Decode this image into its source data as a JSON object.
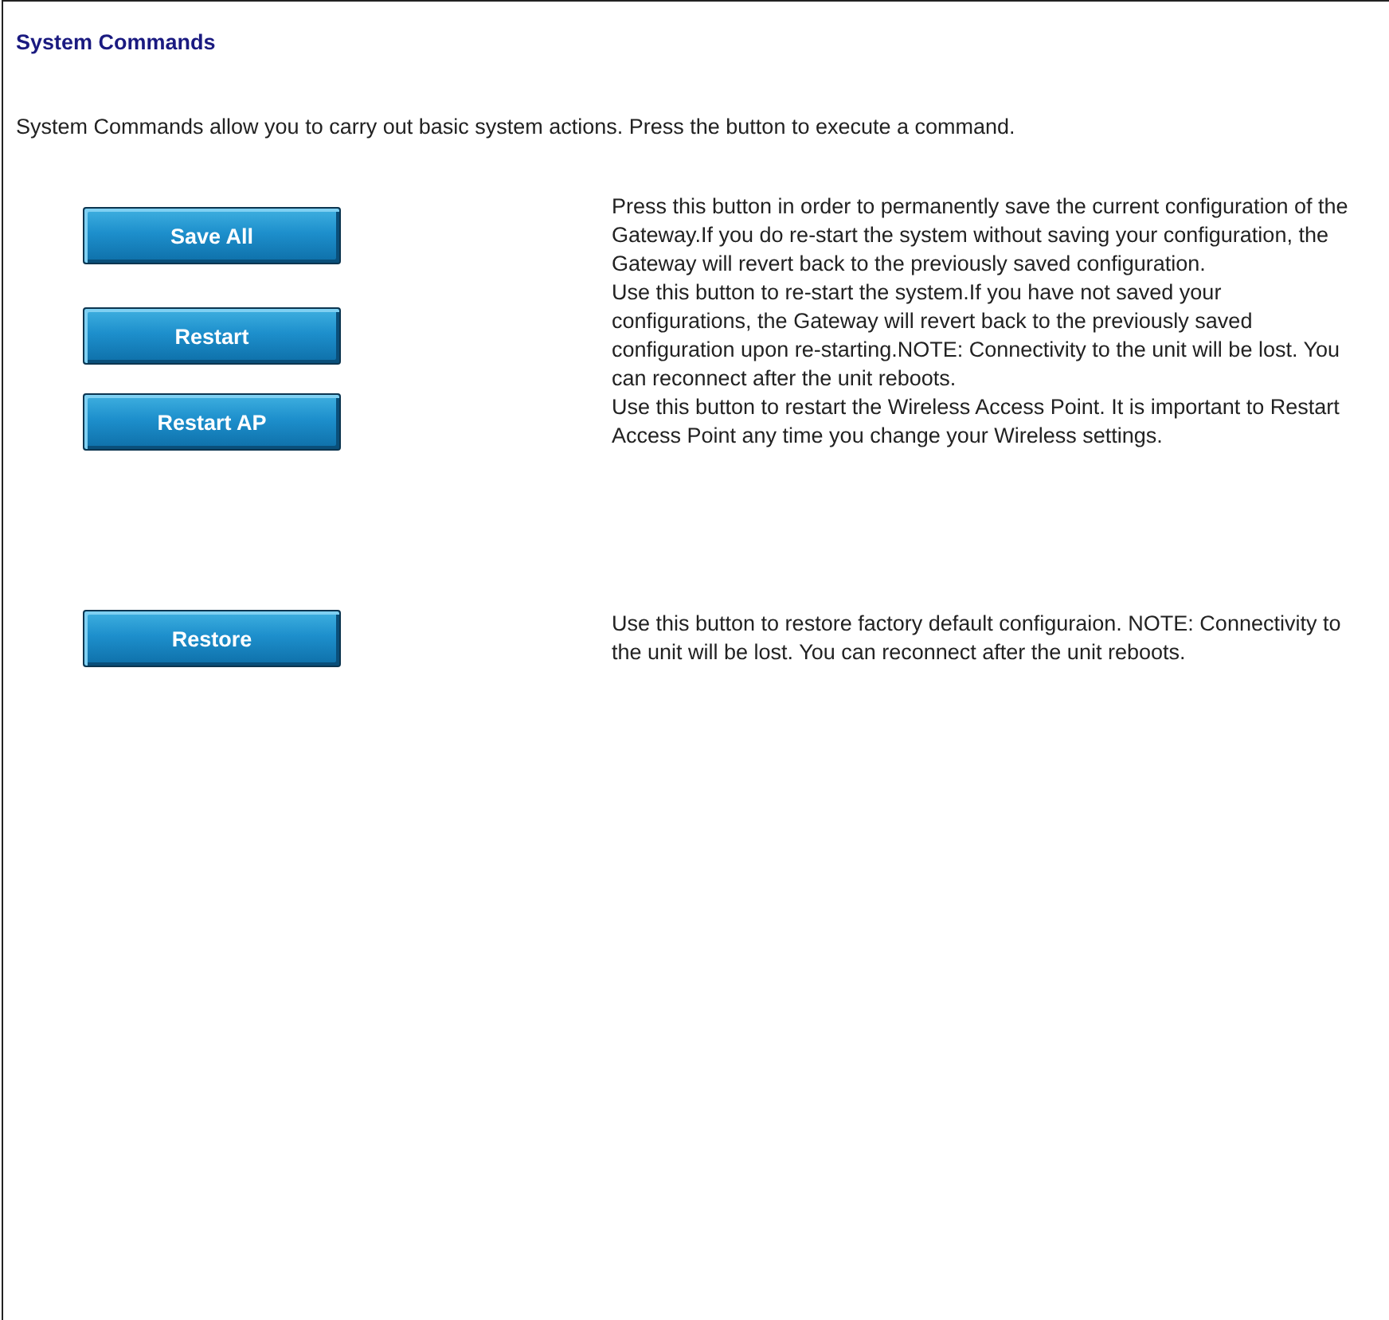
{
  "title": "System Commands",
  "intro": "System Commands allow you to carry out basic system actions. Press the button to execute a command.",
  "commands": [
    {
      "button": "Save All",
      "description": "Press this button in order to permanently save the current configuration of the Gateway.If you do re-start the system without saving your configuration, the Gateway will revert back to the previously saved configuration."
    },
    {
      "button": "Restart",
      "description": "Use this button to re-start the system.If you have not saved your configurations, the Gateway will revert back to the previously saved configuration upon re-starting.NOTE: Connectivity to the unit will be lost. You can reconnect after the unit reboots."
    },
    {
      "button": "Restart AP",
      "description": "Use this button to restart the Wireless Access Point. It is important to Restart Access Point any time you change your Wireless settings."
    },
    {
      "button": "Restore",
      "description": "Use this button to restore factory default configuraion. NOTE: Connectivity to the unit will be lost. You can reconnect after the unit reboots."
    }
  ]
}
